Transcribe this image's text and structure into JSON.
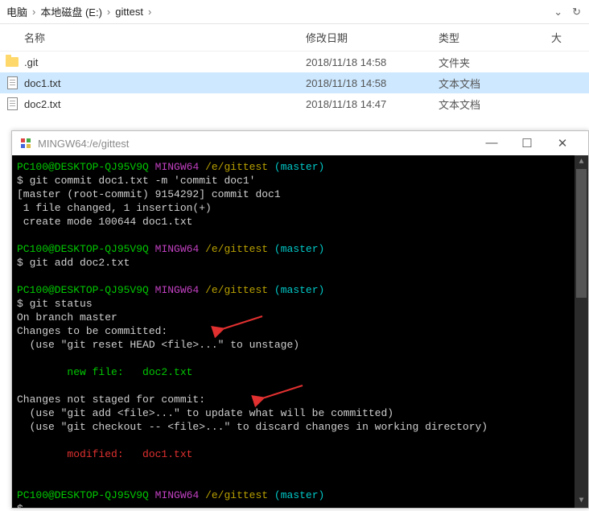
{
  "breadcrumb": {
    "seg1": "电脑",
    "seg2": "本地磁盘 (E:)",
    "seg3": "gittest"
  },
  "columns": {
    "name": "名称",
    "date": "修改日期",
    "type": "类型",
    "extra": "大"
  },
  "files": [
    {
      "name": ".git",
      "date": "2018/11/18 14:58",
      "type": "文件夹",
      "kind": "folder",
      "sel": false
    },
    {
      "name": "doc1.txt",
      "date": "2018/11/18 14:58",
      "type": "文本文档",
      "kind": "doc",
      "sel": true
    },
    {
      "name": "doc2.txt",
      "date": "2018/11/18 14:47",
      "type": "文本文档",
      "kind": "doc",
      "sel": false
    }
  ],
  "term": {
    "title": "MINGW64:/e/gittest",
    "prompt": {
      "user": "PC100@DESKTOP-QJ95V9Q",
      "shell": "MINGW64",
      "path": "/e/gittest",
      "branch": "(master)"
    },
    "cmd1": "$ git commit doc1.txt -m 'commit doc1'",
    "out1a": "[master (root-commit) 9154292] commit doc1",
    "out1b": " 1 file changed, 1 insertion(+)",
    "out1c": " create mode 100644 doc1.txt",
    "cmd2": "$ git add doc2.txt",
    "cmd3": "$ git status",
    "st1": "On branch master",
    "st2": "Changes to be committed:",
    "st3": "  (use \"git reset HEAD <file>...\" to unstage)",
    "st4": "        new file:   doc2.txt",
    "st5": "Changes not staged for commit:",
    "st6": "  (use \"git add <file>...\" to update what will be committed)",
    "st7": "  (use \"git checkout -- <file>...\" to discard changes in working directory)",
    "st8": "        modified:   doc1.txt",
    "prompt_end": "$ "
  }
}
